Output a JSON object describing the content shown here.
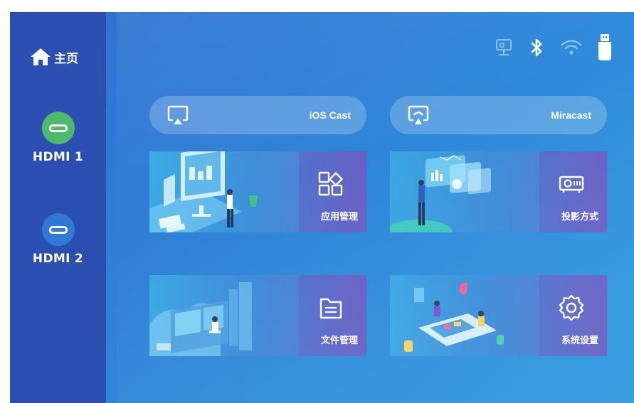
{
  "sidebar": {
    "home_label": "主页",
    "inputs": [
      {
        "label": "HDMI 1",
        "color": "#4cba6a"
      },
      {
        "label": "HDMI 2",
        "color": "#2f78d6"
      }
    ]
  },
  "status_icons": [
    "ethernet-icon",
    "bluetooth-icon",
    "wifi-icon",
    "usb-drive-icon"
  ],
  "cast": {
    "ios": "iOS Cast",
    "miracast": "Miracast"
  },
  "tiles": {
    "apps": "应用管理",
    "projection": "投影方式",
    "files": "文件管理",
    "settings": "系统设置"
  }
}
